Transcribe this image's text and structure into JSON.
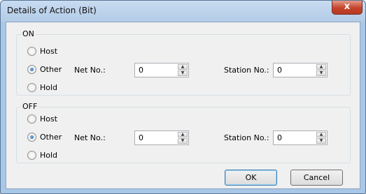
{
  "window": {
    "title": "Details of Action (Bit)",
    "close_glyph": "x"
  },
  "on_group": {
    "legend": "ON",
    "options": {
      "host": "Host",
      "other": "Other",
      "hold": "Hold"
    },
    "selected": "other",
    "net_no_label": "Net No.:",
    "net_no_value": "0",
    "station_no_label": "Station No.:",
    "station_no_value": "0"
  },
  "off_group": {
    "legend": "OFF",
    "options": {
      "host": "Host",
      "other": "Other",
      "hold": "Hold"
    },
    "selected": "other",
    "net_no_label": "Net No.:",
    "net_no_value": "0",
    "station_no_label": "Station No.:",
    "station_no_value": "0"
  },
  "buttons": {
    "ok": "OK",
    "cancel": "Cancel"
  },
  "icons": {
    "spin_up": "▲",
    "spin_down": "▼"
  },
  "colors": {
    "titlebar": "#b3cbe6",
    "close_button": "#c4432a",
    "client": "#f0f0f0",
    "default_button_border": "#3c7fb1"
  }
}
